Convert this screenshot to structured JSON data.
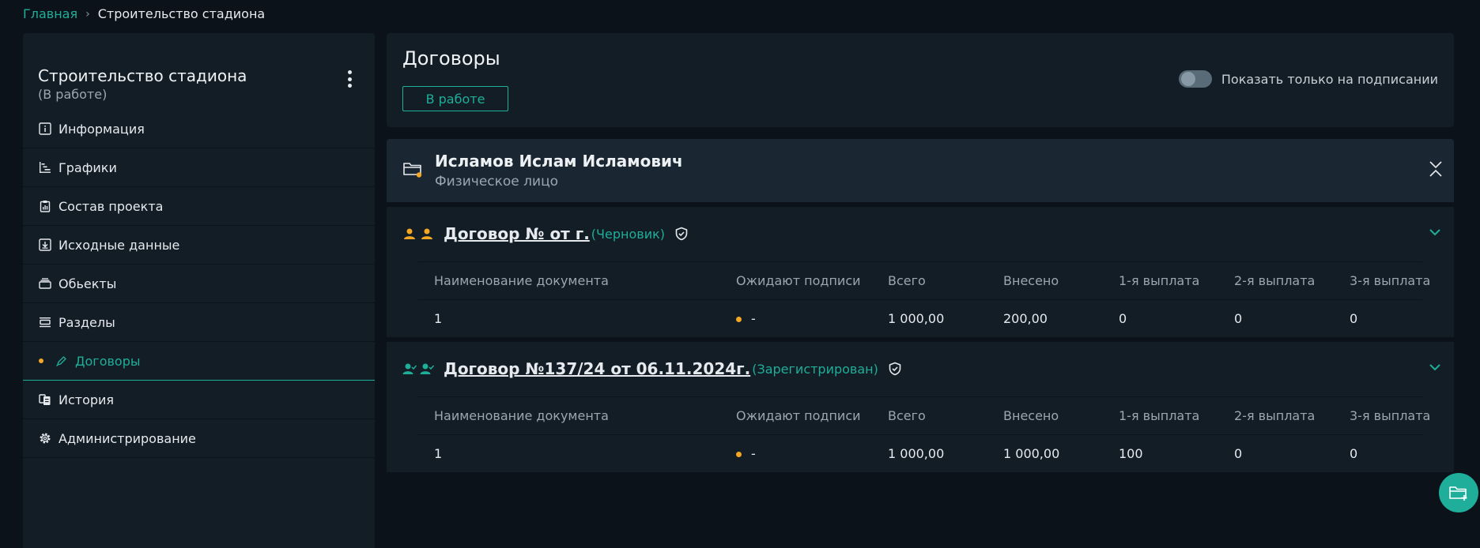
{
  "breadcrumb": {
    "home": "Главная",
    "current": "Строительство стадиона"
  },
  "sidebar": {
    "title": "Строительство стадиона",
    "subtitle": "(В работе)",
    "items": [
      {
        "label": "Информация",
        "icon": "info-icon"
      },
      {
        "label": "Графики",
        "icon": "gantt-icon"
      },
      {
        "label": "Состав проекта",
        "icon": "clipboard-chart-icon"
      },
      {
        "label": "Исходные данные",
        "icon": "download-box-icon"
      },
      {
        "label": "Обьекты",
        "icon": "layers-icon"
      },
      {
        "label": "Разделы",
        "icon": "sections-icon"
      },
      {
        "label": "Договоры",
        "icon": "pen-icon",
        "active": true
      },
      {
        "label": "История",
        "icon": "history-icon"
      },
      {
        "label": "Администрирование",
        "icon": "gear-icon"
      }
    ]
  },
  "header": {
    "title": "Договоры",
    "status_button": "В работе",
    "toggle_label": "Показать только на подписании",
    "toggle_on": false
  },
  "person": {
    "name": "Исламов Ислам Исламович",
    "type": "Физическое лицо"
  },
  "table_headers": [
    "Наименование документа",
    "Ожидают подписи",
    "Всего",
    "Внесено",
    "1-я выплата",
    "2-я выплата",
    "3-я выплата"
  ],
  "contracts": [
    {
      "title": "Договор № от г.",
      "status": "(Черновик)",
      "row": {
        "name": "1",
        "awaiting": "-",
        "total": "1 000,00",
        "paid": "200,00",
        "p1": "0",
        "p2": "0",
        "p3": "0"
      }
    },
    {
      "title": "Договор №137/24 от 06.11.2024г.",
      "status": "(Зарегистрирован)",
      "row": {
        "name": "1",
        "awaiting": "-",
        "total": "1 000,00",
        "paid": "1 000,00",
        "p1": "100",
        "p2": "0",
        "p3": "0"
      }
    }
  ],
  "colors": {
    "accent": "#1fae99",
    "warning": "#f5a623",
    "panel": "#131d26",
    "background": "#0b1219"
  }
}
